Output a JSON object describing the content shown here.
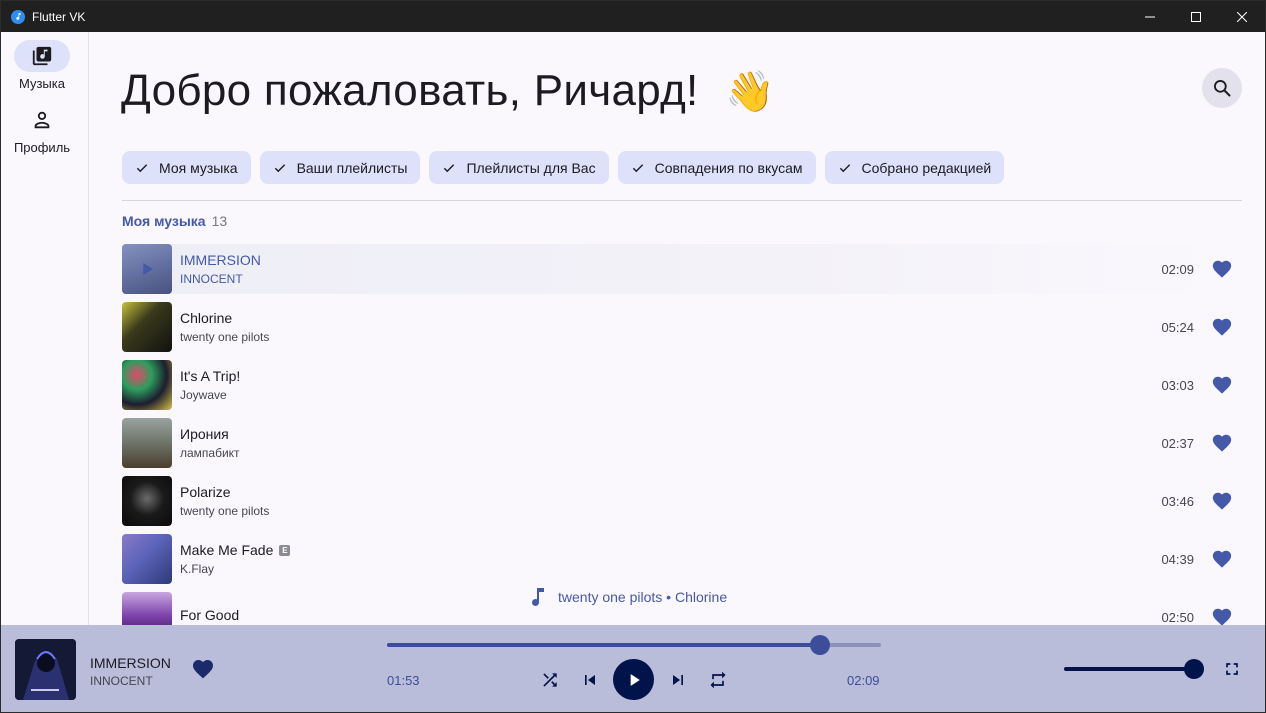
{
  "window": {
    "title": "Flutter VK"
  },
  "sidebar": {
    "items": [
      {
        "label": "Музыка",
        "icon": "music-library-icon",
        "active": true
      },
      {
        "label": "Профиль",
        "icon": "person-icon",
        "active": false
      }
    ]
  },
  "main": {
    "greeting": "Добро пожаловать, Ричард!",
    "greeting_emoji": "👋",
    "chips": [
      {
        "label": "Моя музыка",
        "selected": true
      },
      {
        "label": "Ваши плейлисты",
        "selected": true
      },
      {
        "label": "Плейлисты для Вас",
        "selected": true
      },
      {
        "label": "Совпадения по вкусам",
        "selected": true
      },
      {
        "label": "Собрано редакцией",
        "selected": true
      }
    ],
    "section": {
      "title": "Моя музыка",
      "count": "13"
    },
    "tracks": [
      {
        "title": "IMMERSION",
        "artist": "INNOCENT",
        "duration": "02:09",
        "liked": true,
        "playing": true,
        "explicit": false
      },
      {
        "title": "Chlorine",
        "artist": "twenty one pilots",
        "duration": "05:24",
        "liked": true,
        "playing": false,
        "explicit": false
      },
      {
        "title": "It's A Trip!",
        "artist": "Joywave",
        "duration": "03:03",
        "liked": true,
        "playing": false,
        "explicit": false
      },
      {
        "title": "Ирония",
        "artist": "лампабикт",
        "duration": "02:37",
        "liked": true,
        "playing": false,
        "explicit": false
      },
      {
        "title": "Polarize",
        "artist": "twenty one pilots",
        "duration": "03:46",
        "liked": true,
        "playing": false,
        "explicit": false
      },
      {
        "title": "Make Me Fade",
        "artist": "K.Flay",
        "duration": "04:39",
        "liked": true,
        "playing": false,
        "explicit": true,
        "explicit_label": "E"
      },
      {
        "title": "For Good",
        "artist": "",
        "duration": "02:50",
        "liked": true,
        "playing": false,
        "explicit": false
      }
    ],
    "next_hint": "twenty one pilots • Chlorine"
  },
  "player": {
    "title": "IMMERSION",
    "artist": "INNOCENT",
    "liked": true,
    "current_time": "01:53",
    "total_time": "02:09",
    "progress_fraction": 0.876,
    "volume_fraction": 1.0
  },
  "colors": {
    "accent": "#4559a9",
    "chip_bg": "#dde1f9",
    "player_bg": "#b9bdd9",
    "dark_control": "#00134a"
  }
}
